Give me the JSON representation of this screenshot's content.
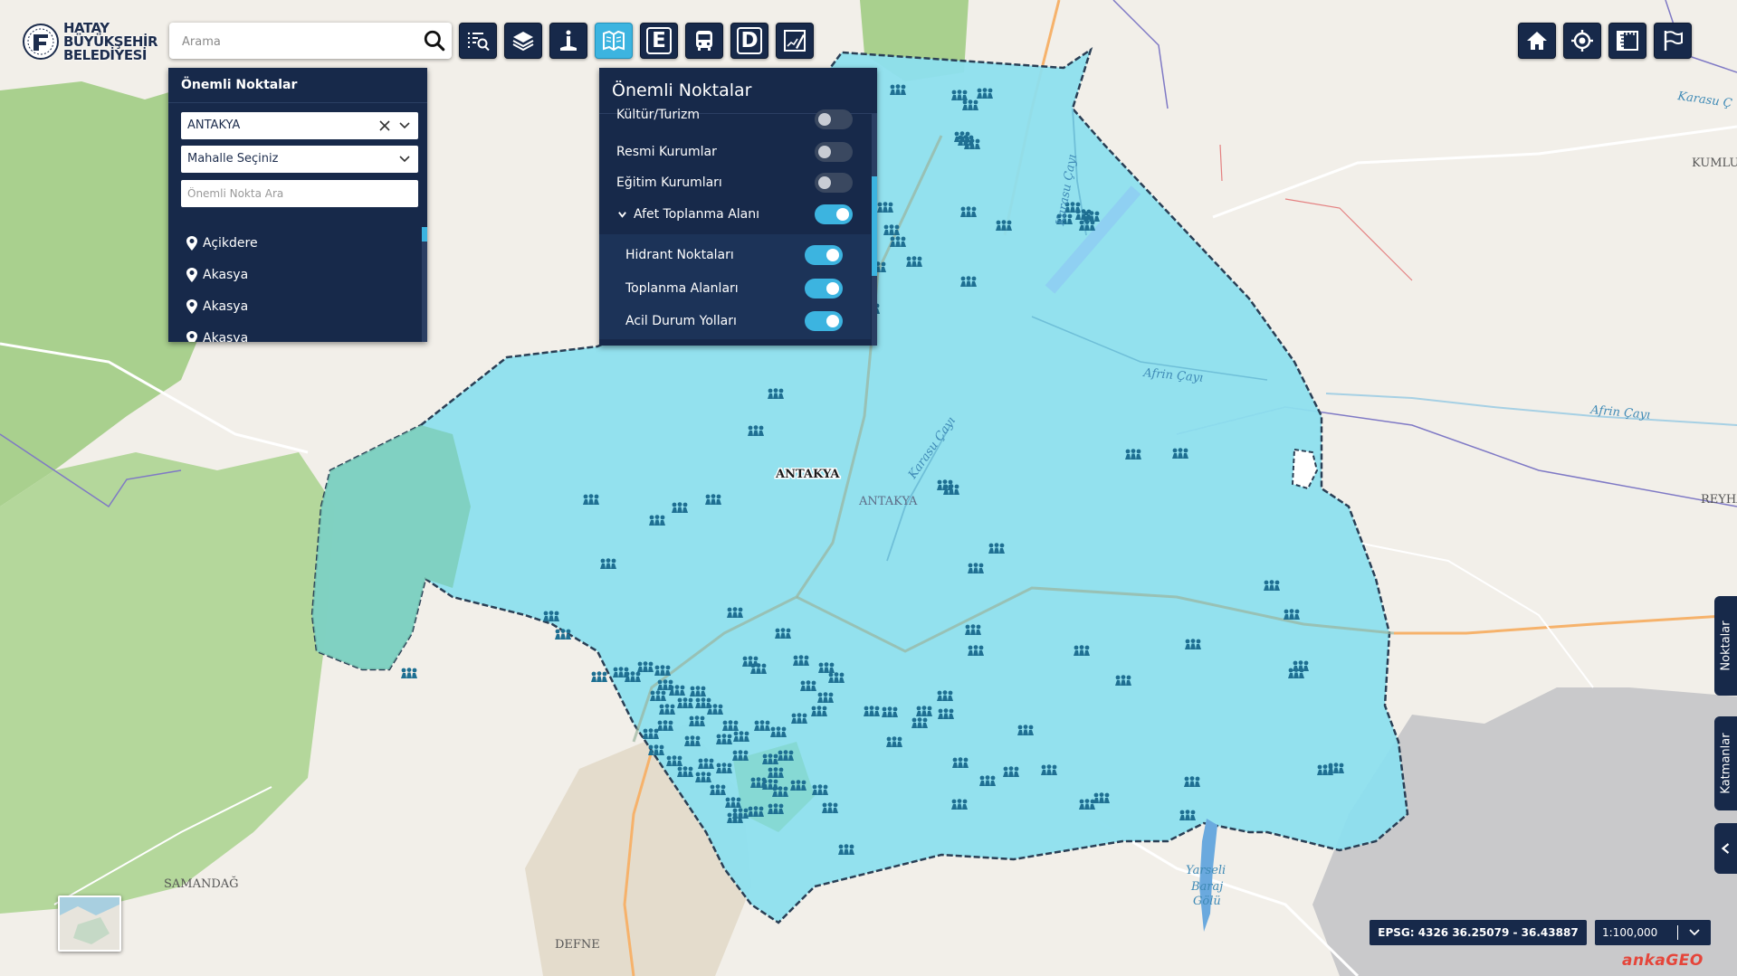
{
  "logo": {
    "line1": "HATAY",
    "line2": "BÜYÜKŞEHİR",
    "line3": "BELEDİYESİ"
  },
  "search": {
    "placeholder": "Arama"
  },
  "toolbar": {
    "buttons": [
      {
        "icon": "list-search-icon"
      },
      {
        "icon": "layers-icon"
      },
      {
        "icon": "info-point-icon"
      },
      {
        "icon": "map-book-icon",
        "active": true
      },
      {
        "icon": "letter-e-icon",
        "letter": "E"
      },
      {
        "icon": "bus-icon"
      },
      {
        "icon": "letter-d-icon",
        "letter": "D"
      },
      {
        "icon": "map-edit-icon"
      }
    ]
  },
  "right_toolbar": [
    "home-icon",
    "locate-icon",
    "ruler-icon",
    "flag-icon"
  ],
  "left_panel": {
    "title": "Önemli Noktalar",
    "district": "ANTAKYA",
    "neighborhood": "Mahalle Seçiniz",
    "search_placeholder": "Önemli Nokta Ara",
    "items": [
      "Açikdere",
      "Akasya",
      "Akasya",
      "Akasya"
    ]
  },
  "layers_panel": {
    "title": "Önemli Noktalar",
    "rows": [
      {
        "label": "Kültür/Turizm",
        "on": false
      },
      {
        "label": "Resmi Kurumlar",
        "on": false
      },
      {
        "label": "Eğitim Kurumları",
        "on": false
      },
      {
        "label": "Afet Toplanma Alanı",
        "on": true,
        "expanded": true
      },
      {
        "label": "Hidrant Noktaları",
        "on": true,
        "sub": true
      },
      {
        "label": "Toplanma Alanları",
        "on": true,
        "sub": true
      },
      {
        "label": "Acil Durum Yolları",
        "on": true,
        "sub": true
      }
    ]
  },
  "map_labels": {
    "antakya_main": "ANTAKYA",
    "antakya_small": "ANTAKYA",
    "samandag": "SAMANDAĞ",
    "defne": "DEFNE",
    "kumlu": "KUMLU",
    "reyhanli": "REYHA",
    "afrin1": "Afrin Çayı",
    "afrin2": "Afrin Çayı",
    "karasu1": "Karasu Çayı",
    "karasu2": "Karasu Çayı",
    "karasu3": "Karasu Ç",
    "lake1": "Yarseli",
    "lake2": "Baraj",
    "lake3": "Gölü"
  },
  "side_tabs": {
    "points": "Noktalar",
    "layers": "Katmanlar"
  },
  "status": {
    "coords": "EPSG: 4326 36.25079 - 36.43887",
    "scale": "1:100,000",
    "brand": "ankaGEO"
  },
  "colors": {
    "panel": "#17294a",
    "accent": "#3cb4e0",
    "district_fill": "#8ddfee",
    "marker": "#1e7fa0"
  }
}
